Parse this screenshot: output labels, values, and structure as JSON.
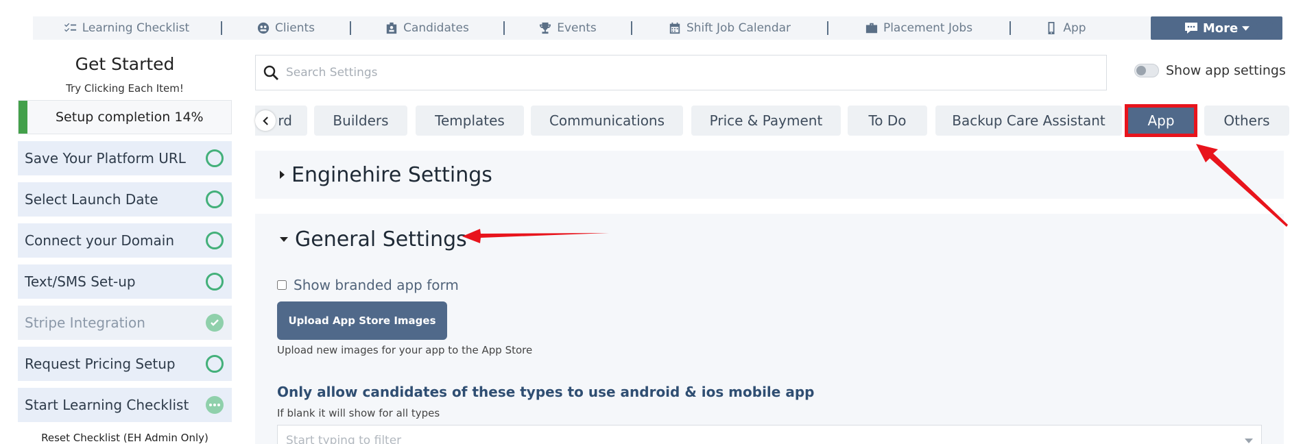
{
  "nav": {
    "items": [
      {
        "label": "Learning Checklist",
        "icon": "checklist-icon"
      },
      {
        "label": "Clients",
        "icon": "clients-icon"
      },
      {
        "label": "Candidates",
        "icon": "candidates-icon"
      },
      {
        "label": "Events",
        "icon": "trophy-icon"
      },
      {
        "label": "Shift Job Calendar",
        "icon": "calendar-icon"
      },
      {
        "label": "Placement Jobs",
        "icon": "briefcase-icon"
      },
      {
        "label": "App",
        "icon": "mobile-icon"
      }
    ],
    "more_label": "More",
    "accent": "#50698a"
  },
  "left": {
    "title": "Get Started",
    "subtitle": "Try Clicking Each Item!",
    "progress_label": "Setup completion 14%",
    "progress_fraction": 0.14,
    "items": [
      {
        "label": "Save Your Platform URL",
        "status": "todo"
      },
      {
        "label": "Select Launch Date",
        "status": "todo"
      },
      {
        "label": "Connect your Domain",
        "status": "todo"
      },
      {
        "label": "Text/SMS Set-up",
        "status": "todo"
      },
      {
        "label": "Stripe Integration",
        "status": "done"
      },
      {
        "label": "Request Pricing Setup",
        "status": "todo"
      },
      {
        "label": "Start Learning Checklist",
        "status": "in-progress"
      }
    ],
    "reset_label": "Reset Checklist (EH Admin Only)"
  },
  "search": {
    "placeholder": "Search Settings"
  },
  "toggle": {
    "label": "Show app settings",
    "on": false
  },
  "tabs": {
    "items": [
      {
        "label": "rd",
        "partial": true
      },
      {
        "label": "Builders"
      },
      {
        "label": "Templates"
      },
      {
        "label": "Communications"
      },
      {
        "label": "Price & Payment"
      },
      {
        "label": "To Do"
      },
      {
        "label": "Backup Care Assistant"
      },
      {
        "label": "App",
        "active": true
      },
      {
        "label": "Others"
      }
    ]
  },
  "panels": {
    "enginehire_title": "Enginehire Settings",
    "general_title": "General Settings"
  },
  "general": {
    "checkbox_label": "Show branded app form",
    "checkbox_checked": false,
    "upload_label": "Upload App Store Images",
    "upload_help": "Upload new images for your app to the App Store",
    "types_title": "Only allow candidates of these types to use android & ios mobile app",
    "types_help": "If blank it will show for all types",
    "filter_placeholder": "Start typing to filter"
  },
  "annotation_color": "#e8141c"
}
